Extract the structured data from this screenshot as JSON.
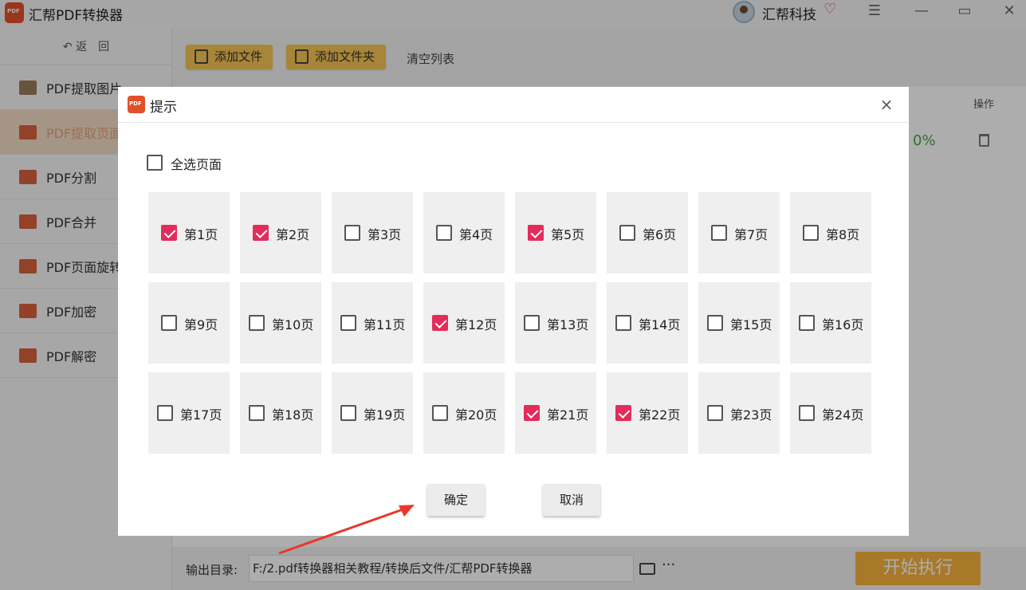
{
  "app": {
    "title": "汇帮PDF转换器",
    "user_name": "汇帮科技",
    "icons": {
      "logo": "pdf-logo-icon",
      "vip": "vip-heart-icon",
      "menu": "menu-icon",
      "minimize": "minimize-icon",
      "maximize": "maximize-icon",
      "close": "close-icon"
    }
  },
  "sidebar": {
    "back_label": "返　回",
    "items": [
      {
        "label": "PDF提取图片"
      },
      {
        "label": "PDF提取页面",
        "active": true
      },
      {
        "label": "PDF分割"
      },
      {
        "label": "PDF合并"
      },
      {
        "label": "PDF页面旋转"
      },
      {
        "label": "PDF加密"
      },
      {
        "label": "PDF解密"
      }
    ]
  },
  "toolbar": {
    "add_file": "添加文件",
    "add_folder": "添加文件夹",
    "clear_list": "清空列表"
  },
  "table": {
    "op_header": "操作",
    "row_progress": "0%"
  },
  "footer": {
    "output_label": "输出目录:",
    "output_path": "F:/2.pdf转换器相关教程/转换后文件/汇帮PDF转换器",
    "more": "···",
    "start": "开始执行"
  },
  "dialog": {
    "title": "提示",
    "close": "×",
    "select_all": "全选页面",
    "select_all_checked": false,
    "pages": [
      {
        "label": "第1页",
        "checked": true
      },
      {
        "label": "第2页",
        "checked": true
      },
      {
        "label": "第3页",
        "checked": false
      },
      {
        "label": "第4页",
        "checked": false
      },
      {
        "label": "第5页",
        "checked": true
      },
      {
        "label": "第6页",
        "checked": false
      },
      {
        "label": "第7页",
        "checked": false
      },
      {
        "label": "第8页",
        "checked": false
      },
      {
        "label": "第9页",
        "checked": false
      },
      {
        "label": "第10页",
        "checked": false
      },
      {
        "label": "第11页",
        "checked": false
      },
      {
        "label": "第12页",
        "checked": true
      },
      {
        "label": "第13页",
        "checked": false
      },
      {
        "label": "第14页",
        "checked": false
      },
      {
        "label": "第15页",
        "checked": false
      },
      {
        "label": "第16页",
        "checked": false
      },
      {
        "label": "第17页",
        "checked": false
      },
      {
        "label": "第18页",
        "checked": false
      },
      {
        "label": "第19页",
        "checked": false
      },
      {
        "label": "第20页",
        "checked": false
      },
      {
        "label": "第21页",
        "checked": true
      },
      {
        "label": "第22页",
        "checked": true
      },
      {
        "label": "第23页",
        "checked": false
      },
      {
        "label": "第24页",
        "checked": false
      }
    ],
    "confirm": "确定",
    "cancel": "取消"
  },
  "colors": {
    "accent": "#f6c454",
    "checked": "#e32c5a",
    "start_button": "#f7b33d",
    "progress_text": "#3daa3d",
    "annotation_arrow": "#e8382c"
  }
}
